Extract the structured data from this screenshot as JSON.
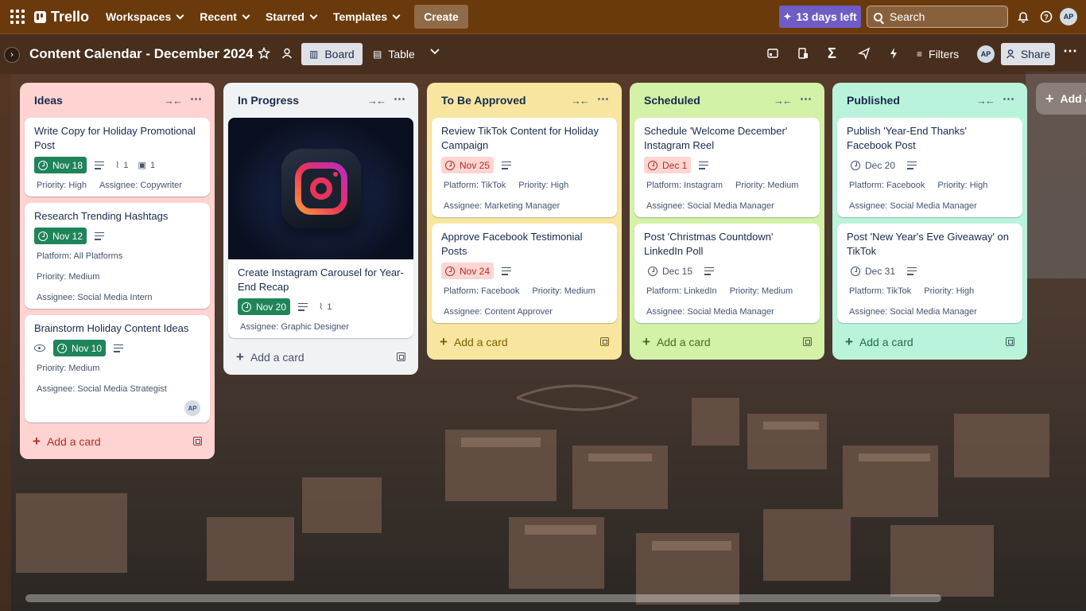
{
  "topnav": {
    "logo": "Trello",
    "items": [
      "Workspaces",
      "Recent",
      "Starred",
      "Templates"
    ],
    "create": "Create",
    "trial": "13 days left",
    "search_placeholder": "Search",
    "user_initials": "AP"
  },
  "board": {
    "title": "Content Calendar - December 2024",
    "views": [
      "Board",
      "Table"
    ],
    "filters": "Filters",
    "share": "Share",
    "user_initials": "AP"
  },
  "lists": [
    {
      "name": "Ideas",
      "color": "#ffd3d1",
      "add_card": "Add a card",
      "cards": [
        {
          "title": "Write Copy for Holiday Promotional Post",
          "due": "Nov 18",
          "attachments": "1",
          "checklist": "1",
          "fields": [
            [
              "Priority: High",
              "Assignee: Copywriter"
            ]
          ]
        },
        {
          "title": "Research Trending Hashtags",
          "due": "Nov 12",
          "fields": [
            [
              "Platform: All Platforms"
            ],
            [
              "Priority: Medium"
            ],
            [
              "Assignee: Social Media Intern"
            ]
          ]
        },
        {
          "title": "Brainstorm Holiday Content Ideas",
          "due": "Nov 10",
          "fields": [
            [
              "Priority: Medium"
            ],
            [
              "Assignee: Social Media Strategist"
            ]
          ],
          "member": "AP"
        }
      ]
    },
    {
      "name": "In Progress",
      "color": "#f1f2f4",
      "add_card": "Add a card",
      "cards": [
        {
          "title": "Create Instagram Carousel for Year-End Recap",
          "due": "Nov 20",
          "attachments": "1",
          "fields": [
            [
              "Assignee: Graphic Designer"
            ]
          ]
        }
      ]
    },
    {
      "name": "To Be Approved",
      "color": "#f8e6a0",
      "add_card": "Add a card",
      "cards": [
        {
          "title": "Review TikTok Content for Holiday Campaign",
          "due": "Nov 25",
          "fields": [
            [
              "Platform: TikTok",
              "Priority: High"
            ],
            [
              "Assignee: Marketing Manager"
            ]
          ]
        },
        {
          "title": "Approve Facebook Testimonial Posts",
          "due": "Nov 24",
          "fields": [
            [
              "Platform: Facebook",
              "Priority: Medium"
            ],
            [
              "Assignee: Content Approver"
            ]
          ]
        }
      ]
    },
    {
      "name": "Scheduled",
      "color": "#d3f1a7",
      "add_card": "Add a card",
      "cards": [
        {
          "title": "Schedule 'Welcome December' Instagram Reel",
          "due": "Dec 1",
          "fields": [
            [
              "Platform: Instagram",
              "Priority: Medium"
            ],
            [
              "Assignee: Social Media Manager"
            ]
          ]
        },
        {
          "title": "Post 'Christmas Countdown' LinkedIn Poll",
          "due": "Dec 15",
          "fields": [
            [
              "Platform: LinkedIn",
              "Priority: Medium"
            ],
            [
              "Assignee: Social Media Manager"
            ]
          ]
        }
      ]
    },
    {
      "name": "Published",
      "color": "#baf3db",
      "add_card": "Add a card",
      "cards": [
        {
          "title": "Publish 'Year-End Thanks' Facebook Post",
          "due": "Dec 20",
          "fields": [
            [
              "Platform: Facebook",
              "Priority: High"
            ],
            [
              "Assignee: Social Media Manager"
            ]
          ]
        },
        {
          "title": "Post 'New Year's Eve Giveaway' on TikTok",
          "due": "Dec 31",
          "fields": [
            [
              "Platform: TikTok",
              "Priority: High"
            ],
            [
              "Assignee: Social Media Manager"
            ]
          ]
        }
      ]
    }
  ],
  "add_list": "Add a"
}
